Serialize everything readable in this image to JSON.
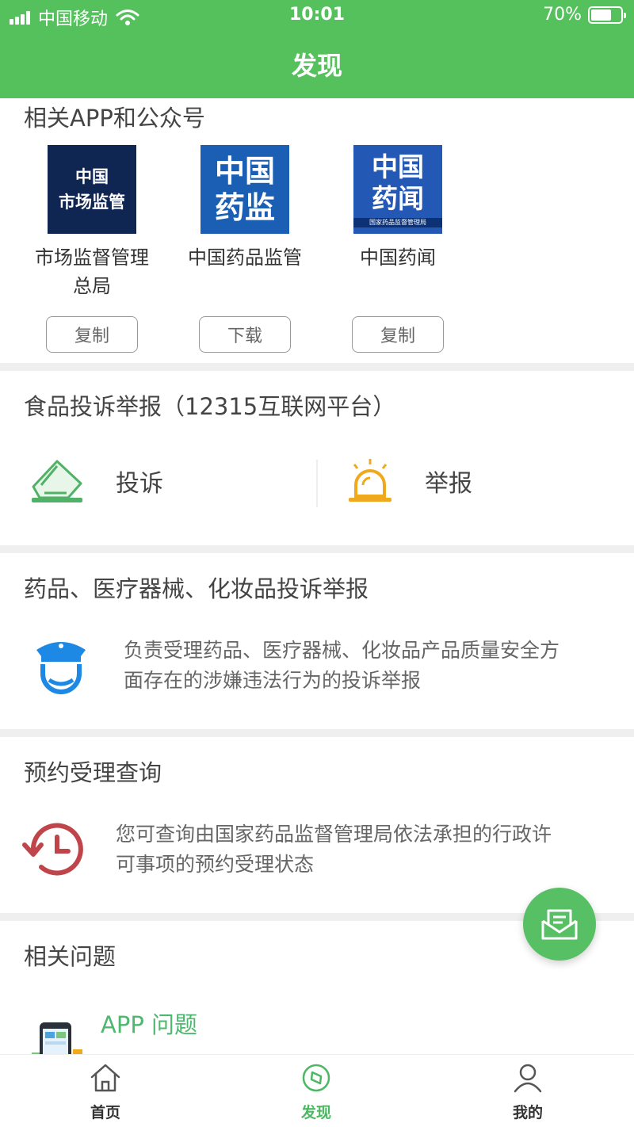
{
  "status_bar": {
    "carrier": "中国移动",
    "time": "10:01",
    "battery_text": "70%",
    "battery_level": 0.7
  },
  "header": {
    "title": "发现"
  },
  "apps_section": {
    "title": "相关APP和公众号",
    "apps": [
      {
        "logo_lines": [
          "中国",
          "市场监管"
        ],
        "name_line1": "市场监督管理",
        "name_line2": "总局",
        "button": "复制"
      },
      {
        "logo_lines": [
          "中国",
          "药监"
        ],
        "name_line1": "中国药品监管",
        "name_line2": "",
        "button": "下载"
      },
      {
        "logo_lines": [
          "中国",
          "药闻",
          "国家药品监督管理局"
        ],
        "name_line1": "中国药闻",
        "name_line2": "",
        "button": "复制"
      }
    ]
  },
  "food_section": {
    "title": "食品投诉举报（12315互联网平台）",
    "complaint": "投诉",
    "report": "举报"
  },
  "drug_section": {
    "title": "药品、医疗器械、化妆品投诉举报",
    "desc_line1": "负责受理药品、医疗器械、化妆品产品质量安全方",
    "desc_line2": "面存在的涉嫌违法行为的投诉举报"
  },
  "appointment_section": {
    "title": "预约受理查询",
    "desc_line1": "您可查询由国家药品监督管理局依法承担的行政许",
    "desc_line2": "可事项的预约受理状态"
  },
  "issues_section": {
    "title": "相关问题",
    "item": "APP 问题"
  },
  "tabbar": {
    "home": "首页",
    "discover": "发现",
    "mine": "我的"
  },
  "colors": {
    "brand_green": "#55c15d",
    "alert_orange": "#f0a81c",
    "police_blue": "#1e88e5",
    "clock_red": "#c0454a"
  },
  "icons": [
    "signal-icon",
    "wifi-icon",
    "battery-icon",
    "complaint-icon",
    "alarm-icon",
    "police-icon",
    "history-clock-icon",
    "phone-icon",
    "mail-icon",
    "home-icon",
    "compass-icon",
    "user-icon"
  ]
}
